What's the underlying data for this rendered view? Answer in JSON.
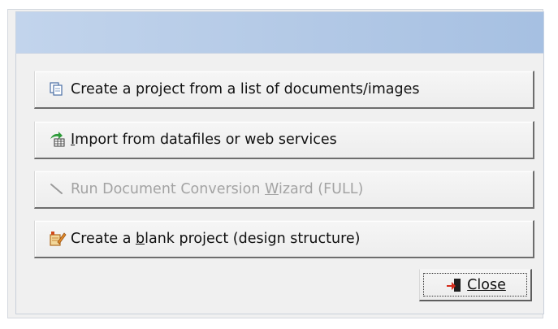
{
  "dialog": {
    "options": [
      {
        "label_pre": "Create a project from a list of documents/images",
        "label_u": "",
        "label_post": "",
        "icon": "copy-documents-icon",
        "enabled": true
      },
      {
        "label_pre": "",
        "label_u": "I",
        "label_post": "mport from datafiles or web services",
        "icon": "import-table-icon",
        "enabled": true
      },
      {
        "label_pre": "Run Document Conversion ",
        "label_u": "W",
        "label_post": "izard (FULL)",
        "icon": "wand-icon",
        "enabled": false
      },
      {
        "label_pre": "Create a ",
        "label_u": "b",
        "label_post": "lank project (design structure)",
        "icon": "blank-project-icon",
        "enabled": true
      }
    ],
    "close_button": {
      "label_u": "C",
      "label_post": "lose",
      "icon": "exit-door-icon"
    },
    "colors": {
      "title_strip": "#b3c9e6",
      "panel_background": "#f0f0f0",
      "disabled_text": "#a3a3a3"
    }
  }
}
